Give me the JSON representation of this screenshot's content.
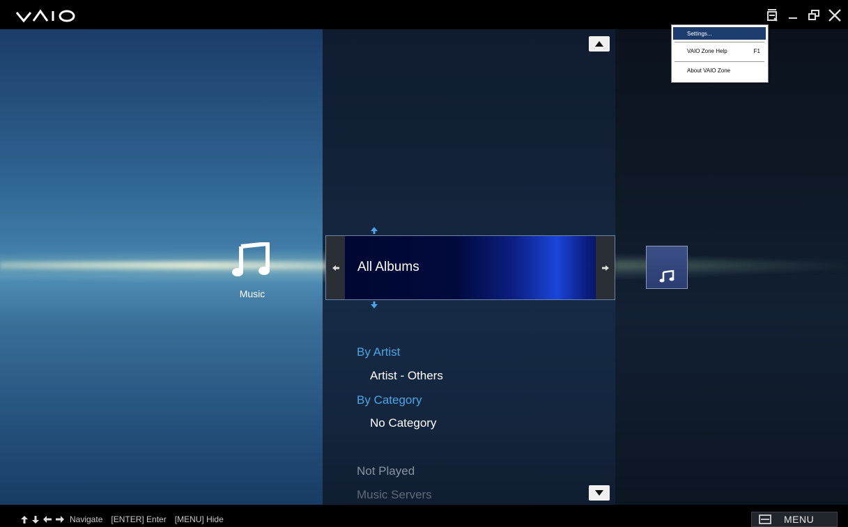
{
  "app": {
    "logo_text": "VAIO"
  },
  "window_controls": [
    "menu-icon",
    "minimize-icon",
    "restore-icon",
    "close-icon"
  ],
  "left_panel": {
    "category_label": "Music",
    "icon": "music-note-icon"
  },
  "selector": {
    "title": "All Albums"
  },
  "menu_items": [
    {
      "label": "By Artist",
      "type": "category"
    },
    {
      "label": "Artist - Others",
      "type": "sub"
    },
    {
      "label": "By Category",
      "type": "category"
    },
    {
      "label": "No Category",
      "type": "sub"
    },
    {
      "label": "Not Played",
      "type": "dim"
    },
    {
      "label": "Music Servers",
      "type": "dimmer"
    }
  ],
  "context_menu": {
    "items": [
      {
        "label": "Settings...",
        "shortcut": "",
        "selected": true
      },
      {
        "label": "VAIO Zone Help",
        "shortcut": "F1",
        "selected": false
      },
      {
        "label": "About VAIO Zone",
        "shortcut": "",
        "selected": false
      }
    ]
  },
  "bottom_bar": {
    "help_navigate": "Navigate",
    "help_enter": "[ENTER] Enter",
    "help_menu": "[MENU] Hide",
    "menu_button_label": "MENU"
  },
  "colors": {
    "accent_blue": "#4aa6e6",
    "selection_bar": "#1a45d8",
    "background": "#000000"
  }
}
